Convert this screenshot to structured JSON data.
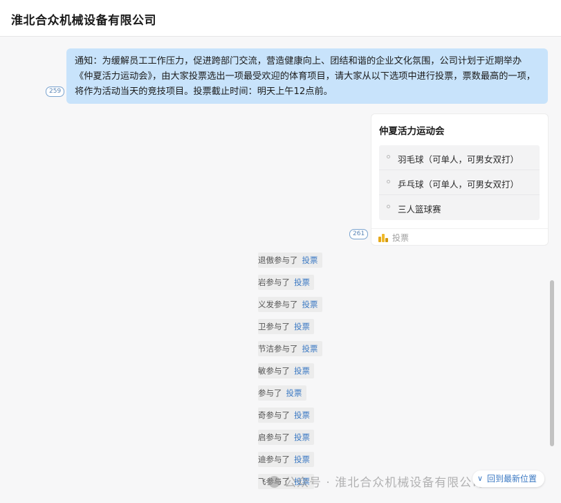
{
  "header": {
    "title": "淮北合众机械设备有限公司"
  },
  "messages": {
    "notice": {
      "read_count": "259",
      "text": "通知：为缓解员工工作压力，促进跨部门交流，营造健康向上、团结和谐的企业文化氛围，公司计划于近期举办《仲夏活力运动会》，由大家投票选出一项最受欢迎的体育项目，请大家从以下选项中进行投票，票数最高的一项，将作为活动当天的竞技项目。投票截止时间：明天上午12点前。"
    },
    "vote": {
      "read_count": "261",
      "title": "仲夏活力运动会",
      "options": [
        "羽毛球（可单人，可男女双打）",
        "乒乓球（可单人，可男女双打）",
        "三人篮球赛"
      ],
      "footer_label": "投票",
      "icon": "bar-chart-icon",
      "icon_colors": [
        "#e6a817",
        "#f0b92a",
        "#d49a10"
      ]
    }
  },
  "activity": [
    {
      "prefix": "退傲参与了",
      "link": "投票"
    },
    {
      "prefix": "岩参与了",
      "link": "投票"
    },
    {
      "prefix": "义发参与了",
      "link": "投票"
    },
    {
      "prefix": "卫参与了",
      "link": "投票"
    },
    {
      "prefix": "节洁参与了",
      "link": "投票"
    },
    {
      "prefix": "敏参与了",
      "link": "投票"
    },
    {
      "prefix": "参与了",
      "link": "投票"
    },
    {
      "prefix": "奇参与了",
      "link": "投票"
    },
    {
      "prefix": "启参与了",
      "link": "投票"
    },
    {
      "prefix": "迪参与了",
      "link": "投票"
    },
    {
      "prefix": "飞参与了",
      "link": "投票"
    }
  ],
  "back_to_latest": {
    "label": "回到最新位置",
    "icon": "chevron-down-icon"
  },
  "watermark": {
    "text": "公众号 · 淮北合众机械设备有限公司"
  },
  "colors": {
    "notice_bubble": "#c8e3fb",
    "link": "#3b79c3",
    "background": "#f7f7f8"
  }
}
